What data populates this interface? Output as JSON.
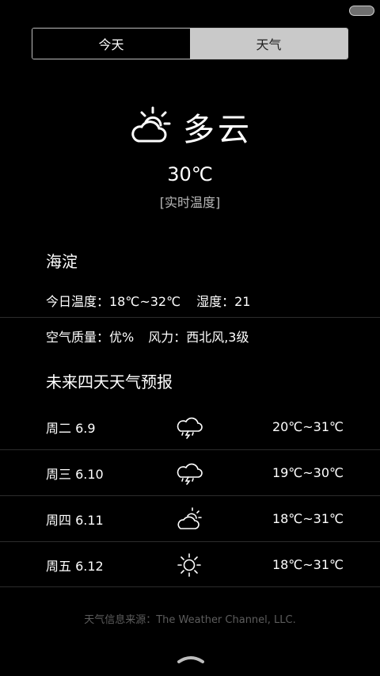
{
  "tabs": [
    {
      "label": "今天",
      "active": true
    },
    {
      "label": "天气",
      "active": false
    }
  ],
  "current": {
    "condition": "多云",
    "icon": "partly-cloudy-icon",
    "temperature": "30℃",
    "temperature_note": "[实时温度]"
  },
  "location": "海淀",
  "details": {
    "today_temp": "今日温度：18℃~32℃",
    "humidity": "湿度：21",
    "air_quality": "空气质量：优%",
    "wind": "风力：西北风,3级"
  },
  "forecast": {
    "title": "未来四天天气预报",
    "days": [
      {
        "day": "周二 6.9",
        "icon": "thunderstorm-icon",
        "range": "20℃~31℃"
      },
      {
        "day": "周三 6.10",
        "icon": "thunderstorm-icon",
        "range": "19℃~30℃"
      },
      {
        "day": "周四 6.11",
        "icon": "partly-cloudy-icon",
        "range": "18℃~31℃"
      },
      {
        "day": "周五 6.12",
        "icon": "sunny-icon",
        "range": "18℃~31℃"
      }
    ]
  },
  "source": "天气信息来源：The Weather Channel, LLC."
}
